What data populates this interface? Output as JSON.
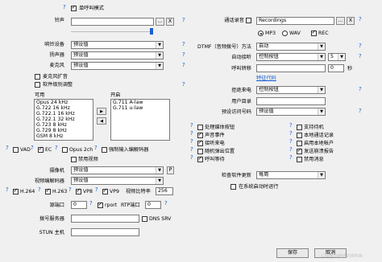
{
  "left": {
    "single_call_mode": "单呼叫模式",
    "ringtone_label": "铃声",
    "ringtone_value": "",
    "ringtone_browse": "...",
    "ringtone_clear": "X",
    "ring_device_label": "响铃设备",
    "ring_device_value": "预设值",
    "speaker_label": "扬声器",
    "speaker_value": "预设值",
    "microphone_label": "麦克风",
    "microphone_value": "预设值",
    "mic_amplify": "麦克风扩音",
    "software_level_adjust": "软件级别调整",
    "available_label": "可用",
    "enabled_label": "开启",
    "available_codecs": [
      "Opus 24 kHz",
      "G.722 16 kHz",
      "G.722.1 16 kHz",
      "G.722.1 32 kHz",
      "G.723 8 kHz",
      "G.729 8 kHz",
      "GSM 8 kHz"
    ],
    "enabled_codecs": [
      "G.711 A-law",
      "G.711 u-law"
    ],
    "move_right": "▶",
    "move_left": "◀",
    "vad": "VAD",
    "ec": "EC",
    "opus_2ch": "Opus 2ch",
    "force_codec": "强制输入编解码器",
    "disable_video": "禁用视频",
    "camera_label": "摄像机",
    "camera_value": "预设值",
    "camera_p": "P",
    "video_codec_label": "视频编解码器",
    "video_codec_value": "预设值",
    "h264": "H.264",
    "h263": "H.263",
    "vp8": "VP8",
    "vp9": "VP9",
    "video_bitrate_label": "视频比特率",
    "video_bitrate_value": "256",
    "source_port_label": "源端口",
    "source_port_value": "0",
    "rport": "rport",
    "rtp_port_label": "RTP端口",
    "rtp_port_value": "0",
    "dial_server_label": "拨号服务器",
    "dial_server_value": "",
    "dns_srv": "DNS SRV",
    "stun_host_label": "STUN 主机",
    "stun_host_value": ""
  },
  "right": {
    "call_recording_label": "通话录音",
    "recording_folder_value": "Recordings",
    "rec_browse": "...",
    "rec_clear": "X",
    "mp3": "MP3",
    "wav": "WAV",
    "rec": "REC",
    "dtmf_label": "DTMF（音频拨号）方法",
    "dtmf_value": "自动",
    "auto_answer_label": "自动接听",
    "auto_answer_value": "控制按钮",
    "auto_answer_seconds": "5",
    "call_forward_label": "呼叫转移",
    "call_forward_value": "",
    "call_forward_seconds": "0",
    "seconds_unit": "秒",
    "prefix_code": "特征代码",
    "reject_call_label": "拒绝来电",
    "reject_call_value": "控制按钮",
    "user_dir_label": "用户目录",
    "user_dir_value": "",
    "preset_access_label": "预设访问号码",
    "preset_access_value": "预设值",
    "hold_button": "处理媒体按钮",
    "sound_events": "声音事件",
    "listen_to_call": "接听来电",
    "random_popup_position": "随机弹出位置",
    "call_waiting": "呼叫等待",
    "support_standby": "支持待机",
    "local_call_log": "本地通话记录",
    "launch_at_start": "启用本地帐户",
    "send_crash_report": "发送崩溃报告",
    "disable_messages": "禁用消息",
    "check_updates_label": "检查软件更新",
    "check_updates_value": "每周",
    "run_at_startup": "在系统启动时运行"
  },
  "footer": {
    "save": "保存",
    "cancel": "取消"
  },
  "watermark": "CSDN @拾光的资料库"
}
